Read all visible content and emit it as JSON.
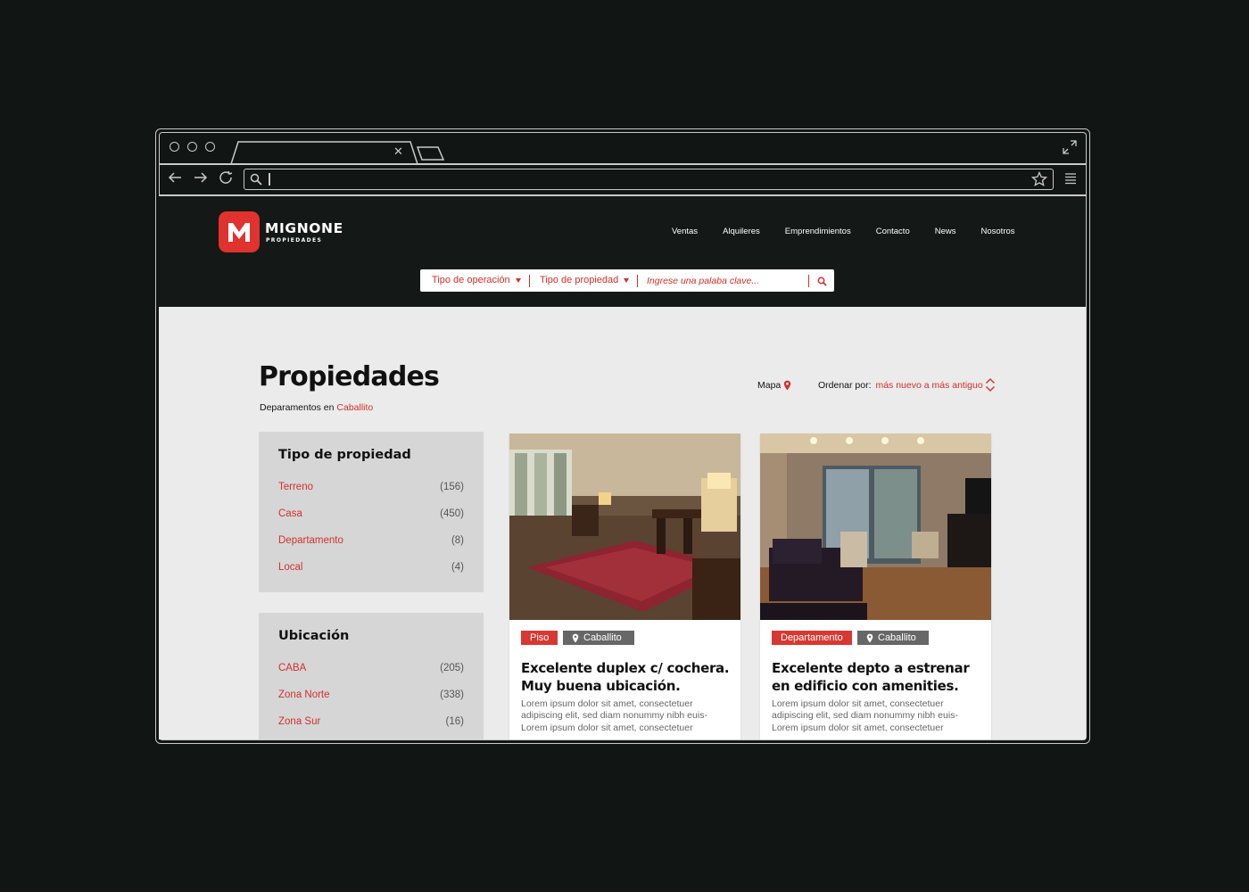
{
  "browser": {
    "address_value": "",
    "window_controls": [
      "close-dot",
      "minimize-dot",
      "maximize-dot"
    ]
  },
  "site": {
    "logo": {
      "name": "MIGNONE",
      "tagline": "PROPIEDADES",
      "brand_color": "#e0322e"
    },
    "nav": [
      "Ventas",
      "Alquileres",
      "Emprendimientos",
      "Contacto",
      "News",
      "Nosotros"
    ],
    "search": {
      "operation_label": "Tipo de operación",
      "property_label": "Tipo de propiedad",
      "placeholder": "Ingrese una palaba clave..."
    }
  },
  "main": {
    "title": "Propiedades",
    "breadcrumb": {
      "prefix": "Deparamentos en",
      "location": "Caballito"
    },
    "map_label": "Mapa",
    "sort": {
      "label": "Ordenar por:",
      "value": "más nuevo a más antiguo"
    }
  },
  "filters": [
    {
      "title": "Tipo de propiedad",
      "items": [
        {
          "label": "Terreno",
          "count": "(156)"
        },
        {
          "label": "Casa",
          "count": "(450)"
        },
        {
          "label": "Departamento",
          "count": "(8)"
        },
        {
          "label": "Local",
          "count": "(4)"
        }
      ]
    },
    {
      "title": "Ubicación",
      "items": [
        {
          "label": "CABA",
          "count": "(205)"
        },
        {
          "label": "Zona Norte",
          "count": "(338)"
        },
        {
          "label": "Zona Sur",
          "count": "(16)"
        }
      ]
    }
  ],
  "listings": [
    {
      "type": "Piso",
      "location": "Caballito",
      "title_line1": "Excelente duplex c/ cochera.",
      "title_line2": "Muy buena ubicación.",
      "description_lines": [
        "Lorem ipsum dolor sit amet, consectetuer",
        "adipiscing elit, sed diam nonummy nibh euis-",
        "Lorem ipsum dolor sit amet, consectetuer"
      ],
      "photo": "living-room-with-red-rug"
    },
    {
      "type": "Departamento",
      "location": "Caballito",
      "title_line1": "Excelente depto a estrenar",
      "title_line2": "en edificio con amenities.",
      "description_lines": [
        "Lorem ipsum dolor sit amet, consectetuer",
        "adipiscing elit, sed diam nonummy nibh euis-",
        "Lorem ipsum dolor sit amet, consectetuer"
      ],
      "photo": "apartment-living-room-with-dark-sofa"
    }
  ],
  "colors": {
    "accent": "#d0302c",
    "header_bg": "#141816",
    "page_bg": "#ebebeb",
    "filter_bg": "#d6d6d6",
    "location_tag": "#676767"
  }
}
